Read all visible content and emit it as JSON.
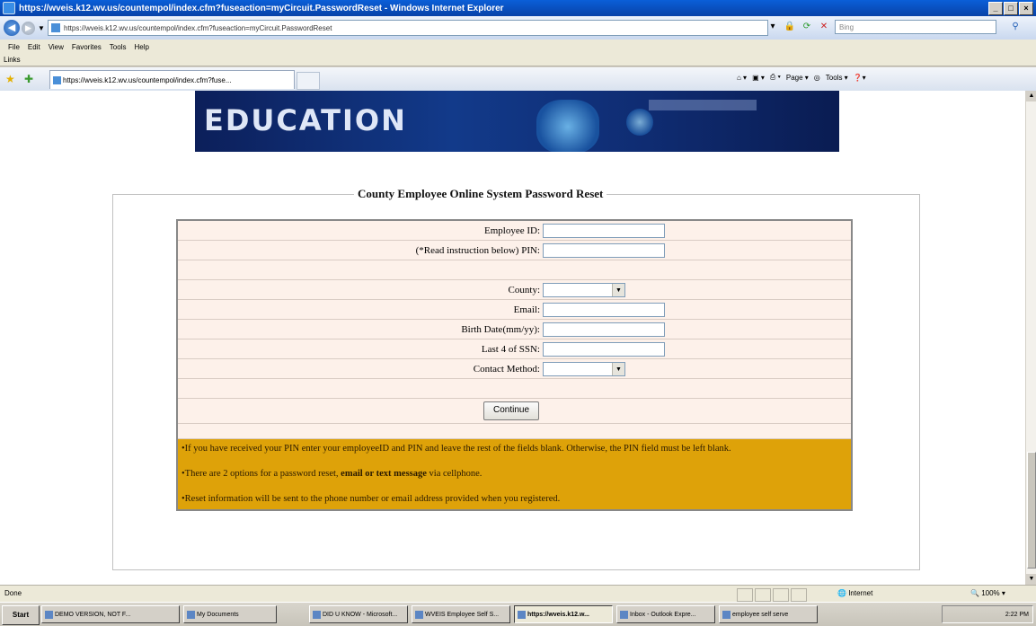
{
  "window": {
    "title": "https://wveis.k12.wv.us/countempol/index.cfm?fuseaction=myCircuit.PasswordReset - Windows Internet Explorer",
    "buttons": [
      "_",
      "□",
      "×"
    ]
  },
  "address": {
    "url": "https://wveis.k12.wv.us/countempol/index.cfm?fuseaction=myCircuit.PasswordReset",
    "search_placeholder": "Bing"
  },
  "menu": [
    "File",
    "Edit",
    "View",
    "Favorites",
    "Tools",
    "Help"
  ],
  "links_label": "Links",
  "tab": {
    "label": "https://wveis.k12.wv.us/countempol/index.cfm?fuse..."
  },
  "commands": [
    "Page ▾",
    "Tools ▾"
  ],
  "banner": {
    "text": "EDUCATION"
  },
  "form": {
    "legend": "County Employee Online System Password Reset",
    "employee_id_label": "Employee ID:",
    "pin_label": "(*Read instruction below) PIN:",
    "county_label": "County:",
    "email_label": "Email:",
    "birth_label": "Birth Date(mm/yy):",
    "ssn_label": "Last 4 of SSN:",
    "contact_label": "Contact Method:",
    "continue": "Continue"
  },
  "instructions": {
    "line1": "•If you have received your PIN enter your employeeID and PIN and leave the rest of the fields blank. Otherwise, the PIN field must be left blank.",
    "line2_pre": "•There are 2 options for a password reset, ",
    "line2_bold": "email or text message",
    "line2_post": " via cellphone.",
    "line3": "•Reset information will be sent to the phone number or email address provided when you registered."
  },
  "status": {
    "done": "Done",
    "zone": "Internet",
    "zoom": "100%"
  },
  "taskbar": {
    "start": "Start",
    "tasks": [
      "DEMO VERSION, NOT F...",
      "My Documents",
      "DID U KNOW - Microsoft...",
      "WVEIS Employee Self S...",
      "https://wveis.k12.w...",
      "Inbox - Outlook Expre...",
      "employee self serve"
    ],
    "clock": "2:22 PM"
  },
  "colors": {
    "instruction_bg": "#dea209",
    "row_bg": "#fdf1ea"
  }
}
